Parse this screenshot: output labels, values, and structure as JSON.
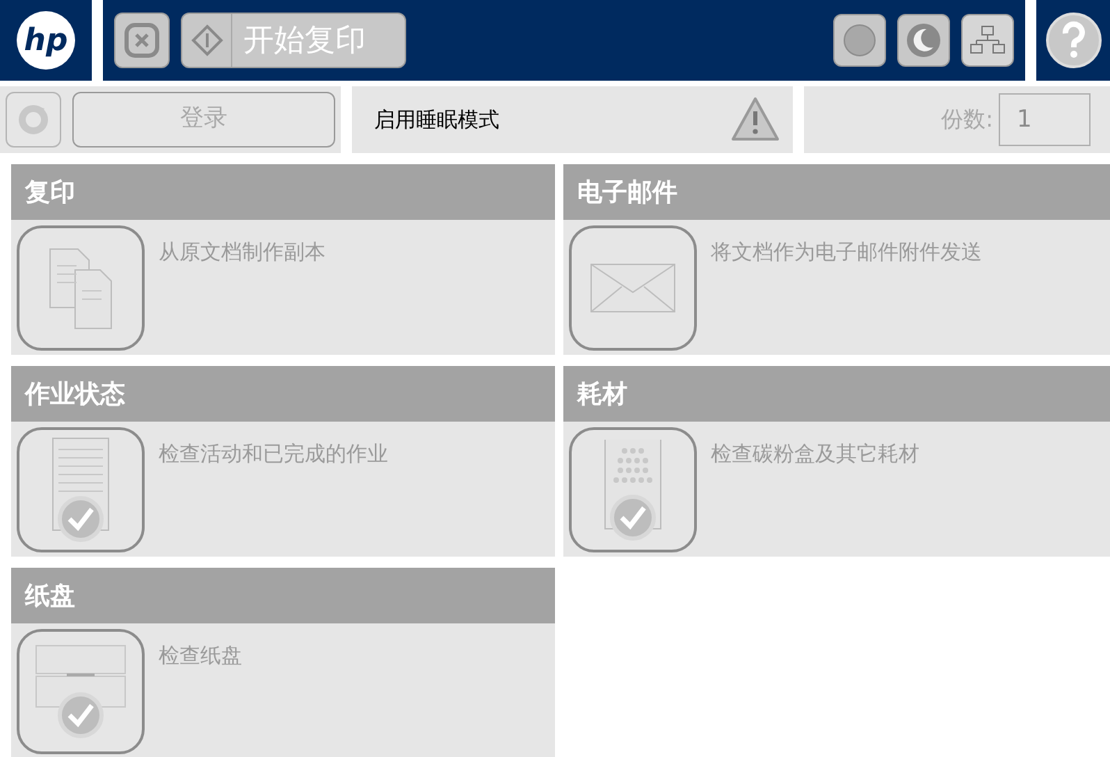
{
  "logo": "hp",
  "top_bar": {
    "start_button": {
      "label": "开始复印",
      "disabled": true
    }
  },
  "login_button": {
    "label": "登录",
    "disabled": true
  },
  "status": {
    "message": "启用睡眠模式"
  },
  "copies": {
    "label": "份数:",
    "value": "1"
  },
  "tiles": [
    {
      "kind": "copy",
      "title": "复印",
      "description": "从原文档制作副本"
    },
    {
      "kind": "email",
      "title": "电子邮件",
      "description": "将文档作为电子邮件附件发送"
    },
    {
      "kind": "jobs",
      "title": "作业状态",
      "description": "检查活动和已完成的作业"
    },
    {
      "kind": "supplies",
      "title": "耗材",
      "description": "检查碳粉盒及其它耗材"
    },
    {
      "kind": "trays",
      "title": "纸盘",
      "description": "检查纸盘"
    }
  ]
}
